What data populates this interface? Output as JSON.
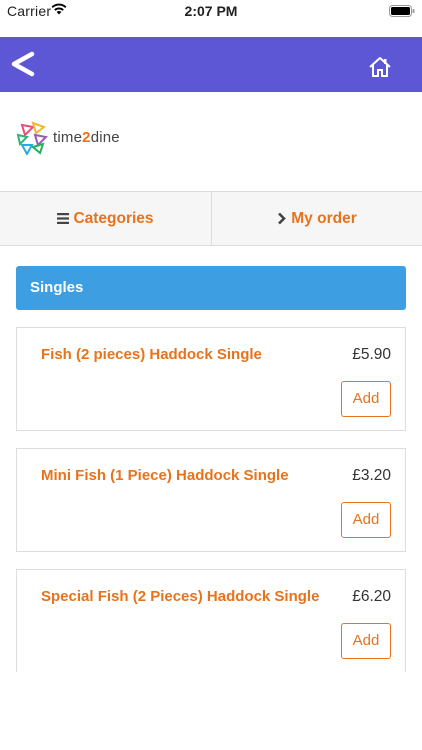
{
  "status_bar": {
    "carrier": "Carrier",
    "time": "2:07 PM"
  },
  "header": {
    "back_icon": "back-chevron-icon",
    "home_icon": "home-icon",
    "background": "#5d57d6"
  },
  "logo": {
    "text_before": "time",
    "text_accent": "2",
    "text_after": "dine"
  },
  "nav": {
    "categories_label": "Categories",
    "my_order_label": "My order",
    "accent": "#e8731c"
  },
  "section": {
    "title": "Singles",
    "color": "#3d9ee2"
  },
  "items": [
    {
      "name": "Fish (2 pieces) Haddock Single",
      "price": "£5.90",
      "button": "Add"
    },
    {
      "name": "Mini Fish (1 Piece) Haddock Single",
      "price": "£3.20",
      "button": "Add"
    },
    {
      "name": "Special Fish (2 Pieces) Haddock Single",
      "price": "£6.20",
      "button": "Add"
    }
  ]
}
